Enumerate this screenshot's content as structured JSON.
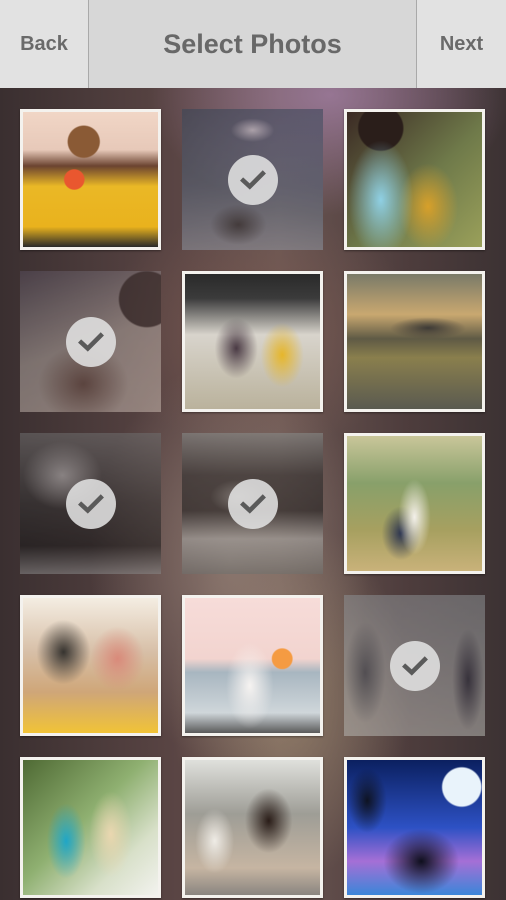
{
  "header": {
    "back_label": "Back",
    "title": "Select Photos",
    "next_label": "Next"
  },
  "photos": [
    {
      "id": 1,
      "selected": false,
      "description": "couple with red tulips, woman in yellow"
    },
    {
      "id": 2,
      "selected": true,
      "description": "couple sitting under heart-shaped cloud"
    },
    {
      "id": 3,
      "selected": false,
      "description": "couple kissing, man in light blue shirt, woman in yellow dress"
    },
    {
      "id": 4,
      "selected": true,
      "description": "close-up couple portrait, purple tone"
    },
    {
      "id": 5,
      "selected": false,
      "description": "couple kissing at train station, woman in yellow"
    },
    {
      "id": 6,
      "selected": false,
      "description": "couple kissing on road at sunset"
    },
    {
      "id": 7,
      "selected": true,
      "description": "black and white embrace"
    },
    {
      "id": 8,
      "selected": true,
      "description": "dark silhouette couple in grass"
    },
    {
      "id": 9,
      "selected": false,
      "description": "man lifting woman in field"
    },
    {
      "id": 10,
      "selected": false,
      "description": "couple on swing"
    },
    {
      "id": 11,
      "selected": false,
      "description": "couple in white on beach"
    },
    {
      "id": 12,
      "selected": true,
      "description": "couple holding hands on beach"
    },
    {
      "id": 13,
      "selected": false,
      "description": "couple embracing in park, man in blue shirt"
    },
    {
      "id": 14,
      "selected": false,
      "description": "couple face to face in city"
    },
    {
      "id": 15,
      "selected": false,
      "description": "silhouette couple under full moon with palm tree"
    }
  ],
  "icons": {
    "check": "check-mark-icon"
  }
}
